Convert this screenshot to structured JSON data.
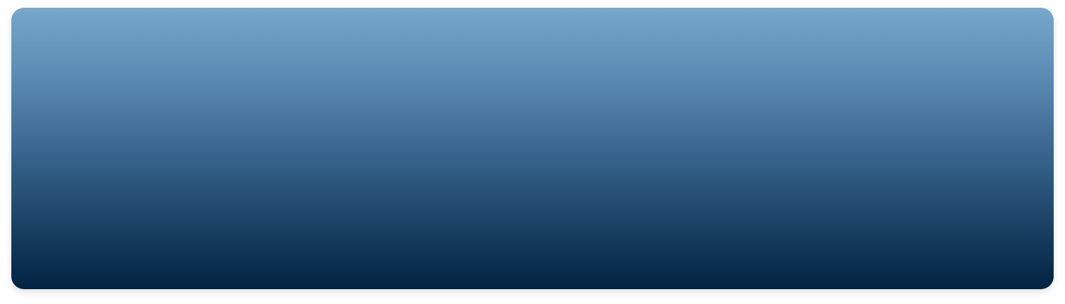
{
  "hero_panel": {
    "gradient_top_color": "#78a7cc",
    "gradient_bottom_color": "#002341"
  }
}
